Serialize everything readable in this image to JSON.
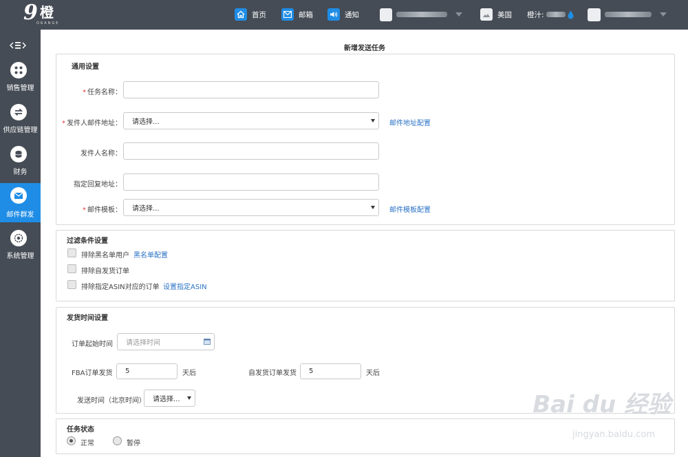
{
  "topbar": {
    "logo_big": "9",
    "logo_mid": "橙",
    "logo_small": "ORANGE",
    "nav": [
      {
        "label": "首页",
        "icon": "home-icon"
      },
      {
        "label": "邮箱",
        "icon": "mail-icon"
      },
      {
        "label": "通知",
        "icon": "speaker-icon"
      }
    ],
    "region_label": "美国",
    "orange_label": "橙汁:"
  },
  "sidebar": {
    "items": [
      {
        "label": "销售管理",
        "icon": "grid-icon"
      },
      {
        "label": "供应链管理",
        "icon": "exchange-icon"
      },
      {
        "label": "财务",
        "icon": "coins-icon"
      },
      {
        "label": "邮件群发",
        "icon": "mail-icon",
        "active": true
      },
      {
        "label": "系统管理",
        "icon": "gear-icon"
      }
    ]
  },
  "page": {
    "title": "新增发送任务"
  },
  "general": {
    "title": "通用设置",
    "task_name_label": "任务名称：",
    "sender_email_label": "发件人邮件地址：",
    "sender_email_value": "请选择...",
    "email_config_link": "邮件地址配置",
    "sender_name_label": "发件人名称：",
    "reply_to_label": "指定回复地址：",
    "template_label": "邮件模板：",
    "template_value": "请选择...",
    "template_config_link": "邮件模板配置"
  },
  "filters": {
    "title": "过滤条件设置",
    "exclude_blacklist": "排除黑名单用户",
    "blacklist_link": "黑名单配置",
    "exclude_self_ship": "排除自发货订单",
    "exclude_asin": "排除指定ASIN对应的订单",
    "asin_link": "设置指定ASIN"
  },
  "shipping": {
    "title": "发货时间设置",
    "order_start_label": "订单起始时间",
    "order_start_placeholder": "请选择时间",
    "fba_label": "FBA订单发货",
    "fba_value": "5",
    "fba_unit": "天后",
    "self_label": "自发货订单发货",
    "self_value": "5",
    "self_unit": "天后",
    "send_time_label": "发送时间（北京时间）",
    "send_time_value": "请选择..."
  },
  "status": {
    "title": "任务状态",
    "normal": "正常",
    "paused": "暂停",
    "selected": "normal"
  },
  "watermark": {
    "text": "Bai du 经验",
    "sub": "jingyan.baidu.com"
  }
}
